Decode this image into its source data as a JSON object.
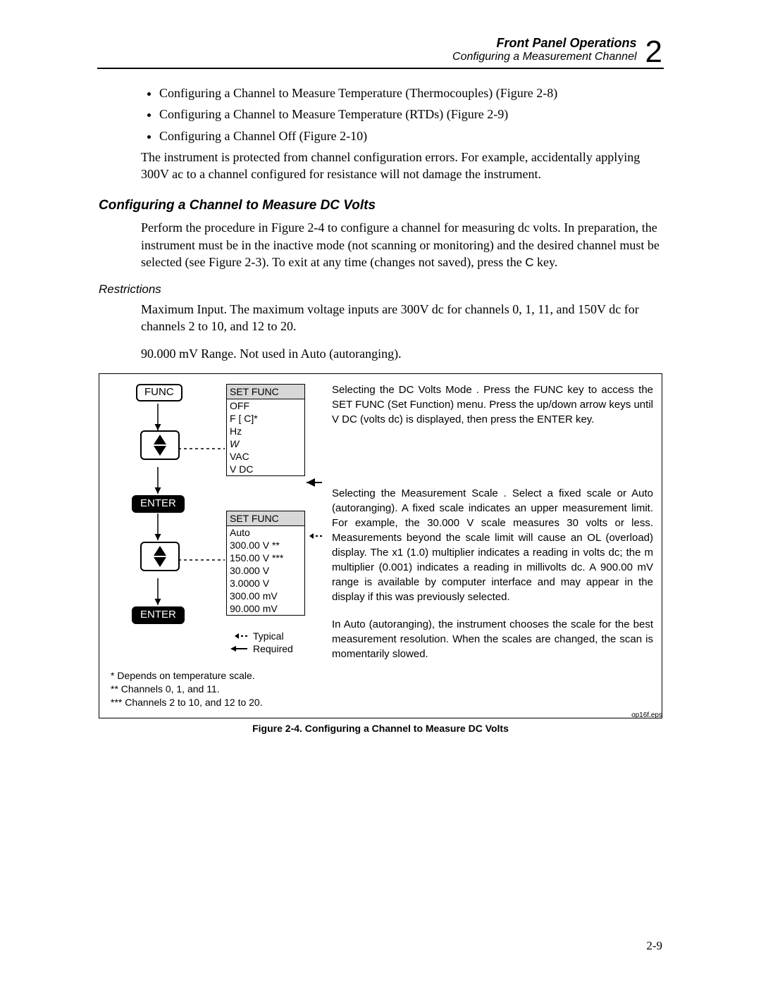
{
  "header": {
    "title": "Front Panel Operations",
    "subtitle": "Configuring a Measurement Channel",
    "chapter_num": "2"
  },
  "bullets": [
    "Configuring a Channel to Measure Temperature (Thermocouples) (Figure 2-8)",
    "Configuring a Channel to Measure Temperature (RTDs) (Figure 2-9)",
    "Configuring a Channel Off (Figure 2-10)"
  ],
  "intro_para": "The instrument is protected from channel configuration errors. For example, accidentally applying 300V ac to a channel configured for resistance will not damage the instrument.",
  "section_heading": "Configuring a Channel to Measure DC Volts",
  "section_para_1a": "Perform the procedure in Figure 2-4 to configure a channel for measuring dc volts. In preparation, the instrument must be in the inactive mode (not scanning or monitoring) and the desired channel must be selected (see Figure 2-3). To exit at any time (changes not saved), press the ",
  "section_para_1_key": "C",
  "section_para_1b": " key.",
  "restrictions_heading": "Restrictions",
  "restrictions_p1": "Maximum Input. The maximum voltage inputs are 300V dc for channels 0, 1, 11, and 150V dc for channels 2 to 10, and 12 to 20.",
  "restrictions_p2": "90.000 mV Range. Not used in Auto (autoranging).",
  "figure": {
    "func_label": "FUNC",
    "enter_label": "ENTER",
    "menu1": {
      "header": "SET FUNC",
      "items": [
        "OFF",
        "F [  C]*",
        "Hz",
        "W",
        "VAC",
        "V DC"
      ]
    },
    "menu2": {
      "header": "SET FUNC",
      "items": [
        "Auto",
        "300.00 V **",
        "150.00 V ***",
        "30.000 V",
        "3.0000 V",
        "300.00 mV",
        "90.000 mV"
      ]
    },
    "legend_typical": "Typical",
    "legend_required": "Required",
    "footnote1": "*   Depends on temperature scale.",
    "footnote2": "**  Channels 0, 1, and 11.",
    "footnote3": "*** Channels 2 to 10, and 12 to 20.",
    "right_p1": "Selecting the DC Volts Mode .  Press the FUNC key to access the SET FUNC (Set Function) menu.  Press the up/down arrow keys until V DC (volts dc) is displayed, then press the ENTER key.",
    "right_p2": "Selecting the Measurement Scale .  Select a fixed scale or Auto (autoranging).  A fixed scale indicates an upper measurement limit.  For example, the 30.000 V scale measures 30 volts or less.  Measurements beyond the scale limit will cause an OL (overload) display.  The x1 (1.0) multiplier indicates a reading in volts dc; the m multiplier (0.001) indicates a reading in millivolts dc.  A 900.00 mV range is available by computer interface and may appear in the display if this was previously selected.",
    "right_p3": "In Auto (autoranging), the instrument chooses the scale for the best measurement resolution. When the scales are changed, the scan is momentarily slowed."
  },
  "caption": "Figure 2-4. Configuring a Channel to Measure DC Volts",
  "eps": "op16f.eps",
  "page_number": "2-9"
}
